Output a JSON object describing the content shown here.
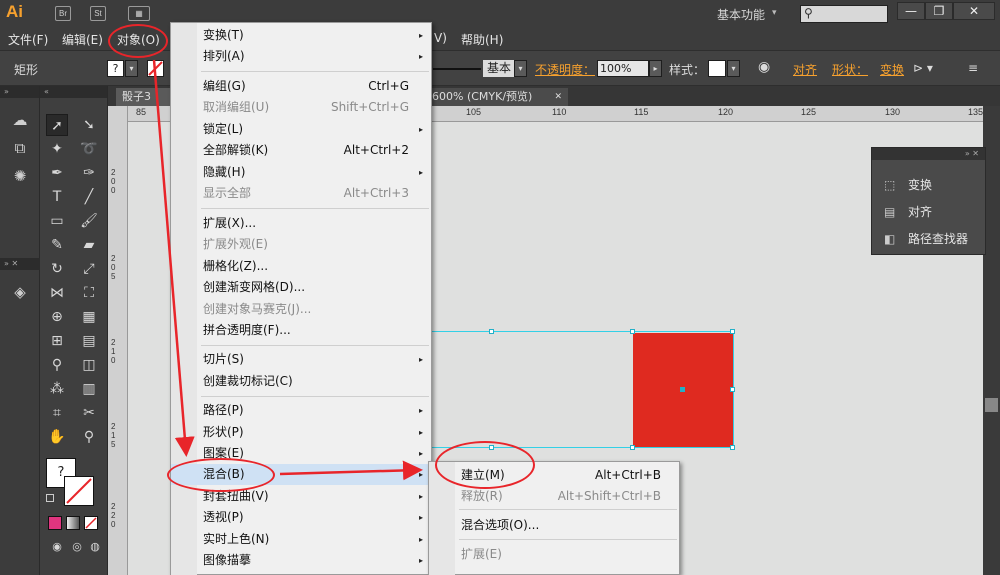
{
  "titlebar": {
    "app_logo": "Ai",
    "bridge_btn": "Br",
    "stock_btn": "St",
    "workspace": "基本功能",
    "workspace_arrow": "▾",
    "search_icon": "⚲",
    "minimize": "—",
    "restore": "❐",
    "close": "✕"
  },
  "menubar": {
    "items": [
      "文件(F)",
      "编辑(E)",
      "对象(O)",
      "V)",
      "帮助(H)"
    ]
  },
  "controlbar": {
    "tool_name": "矩形",
    "fill_question": "?",
    "stroke_style_label": "基本",
    "opacity_label": "不透明度：",
    "opacity_value": "100%",
    "style_label": "样式：",
    "align_label": "对齐",
    "shape_label": "形状：",
    "transform_label": "变换"
  },
  "tabs": {
    "doc1": "骰子3",
    "doc_active": "600% (CMYK/预览)",
    "close_glyph": "✕"
  },
  "ruler": {
    "top": [
      "85",
      "105",
      "110",
      "115",
      "120",
      "125",
      "130",
      "135"
    ],
    "left": [
      "2 0 0",
      "2 0 5",
      "2 1 0",
      "2 1 5",
      "2 2 0"
    ]
  },
  "tools": {
    "question_box": "?"
  },
  "float_panel": {
    "items": [
      {
        "icon": "transform-icon",
        "glyph": "⬚",
        "label": "变换"
      },
      {
        "icon": "align-icon",
        "glyph": "▤",
        "label": "对齐"
      },
      {
        "icon": "pathfinder-icon",
        "glyph": "◧",
        "label": "路径查找器"
      }
    ]
  },
  "object_menu": {
    "items": [
      {
        "label": "变换(T)",
        "shortcut": "",
        "arrow": "▸",
        "disabled": false
      },
      {
        "label": "排列(A)",
        "shortcut": "",
        "arrow": "▸",
        "disabled": false
      },
      {
        "label": "编组(G)",
        "shortcut": "Ctrl+G",
        "arrow": "",
        "disabled": false
      },
      {
        "label": "取消编组(U)",
        "shortcut": "Shift+Ctrl+G",
        "arrow": "",
        "disabled": true
      },
      {
        "label": "锁定(L)",
        "shortcut": "",
        "arrow": "▸",
        "disabled": false
      },
      {
        "label": "全部解锁(K)",
        "shortcut": "Alt+Ctrl+2",
        "arrow": "",
        "disabled": false
      },
      {
        "label": "隐藏(H)",
        "shortcut": "",
        "arrow": "▸",
        "disabled": false
      },
      {
        "label": "显示全部",
        "shortcut": "Alt+Ctrl+3",
        "arrow": "",
        "disabled": true
      },
      {
        "label": "扩展(X)...",
        "shortcut": "",
        "arrow": "",
        "disabled": false
      },
      {
        "label": "扩展外观(E)",
        "shortcut": "",
        "arrow": "",
        "disabled": true
      },
      {
        "label": "栅格化(Z)...",
        "shortcut": "",
        "arrow": "",
        "disabled": false
      },
      {
        "label": "创建渐变网格(D)...",
        "shortcut": "",
        "arrow": "",
        "disabled": false
      },
      {
        "label": "创建对象马赛克(J)...",
        "shortcut": "",
        "arrow": "",
        "disabled": true
      },
      {
        "label": "拼合透明度(F)...",
        "shortcut": "",
        "arrow": "",
        "disabled": false
      },
      {
        "label": "切片(S)",
        "shortcut": "",
        "arrow": "▸",
        "disabled": false
      },
      {
        "label": "创建裁切标记(C)",
        "shortcut": "",
        "arrow": "",
        "disabled": false
      },
      {
        "label": "路径(P)",
        "shortcut": "",
        "arrow": "▸",
        "disabled": false
      },
      {
        "label": "形状(P)",
        "shortcut": "",
        "arrow": "▸",
        "disabled": false
      },
      {
        "label": "图案(E)",
        "shortcut": "",
        "arrow": "▸",
        "disabled": false
      },
      {
        "label": "混合(B)",
        "shortcut": "",
        "arrow": "▸",
        "disabled": false
      },
      {
        "label": "封套扭曲(V)",
        "shortcut": "",
        "arrow": "▸",
        "disabled": false
      },
      {
        "label": "透视(P)",
        "shortcut": "",
        "arrow": "▸",
        "disabled": false
      },
      {
        "label": "实时上色(N)",
        "shortcut": "",
        "arrow": "▸",
        "disabled": false
      },
      {
        "label": "图像描摹",
        "shortcut": "",
        "arrow": "▸",
        "disabled": false
      }
    ]
  },
  "blend_submenu": {
    "items": [
      {
        "label": "建立(M)",
        "shortcut": "Alt+Ctrl+B",
        "disabled": false
      },
      {
        "label": "释放(R)",
        "shortcut": "Alt+Shift+Ctrl+B",
        "disabled": true
      },
      {
        "label": "混合选项(O)...",
        "shortcut": "",
        "disabled": false
      },
      {
        "label": "扩展(E)",
        "shortcut": "",
        "disabled": true
      }
    ]
  },
  "colors": {
    "accent_orange": "#f7a12e",
    "annotation_red": "#e8252a",
    "rect_fill": "#df2a20",
    "selection_cyan": "#33d0e6"
  }
}
